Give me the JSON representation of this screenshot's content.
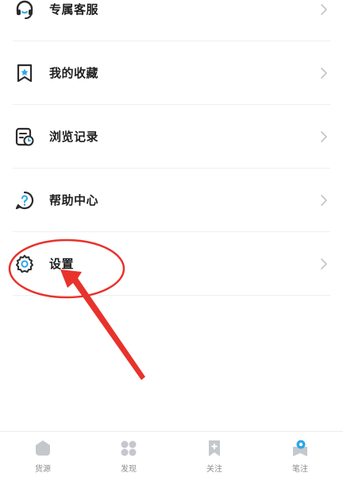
{
  "menu": {
    "items": [
      {
        "label": "专属客服",
        "icon": "headset-icon"
      },
      {
        "label": "我的收藏",
        "icon": "bookmark-star-icon"
      },
      {
        "label": "浏览记录",
        "icon": "history-icon"
      },
      {
        "label": "帮助中心",
        "icon": "help-icon"
      },
      {
        "label": "设置",
        "icon": "gear-icon"
      }
    ]
  },
  "tabbar": {
    "items": [
      {
        "label": "货源",
        "icon": "home-icon"
      },
      {
        "label": "发现",
        "icon": "grid-icon"
      },
      {
        "label": "关注",
        "icon": "bookmark-plus-icon"
      },
      {
        "label": "笔注",
        "icon": "profile-icon"
      }
    ]
  },
  "colors": {
    "annotation_red": "#e8322c",
    "icon_dark": "#2b2b2b",
    "accent_blue": "#2aa7e8",
    "tab_inactive": "#c4c8cc"
  }
}
